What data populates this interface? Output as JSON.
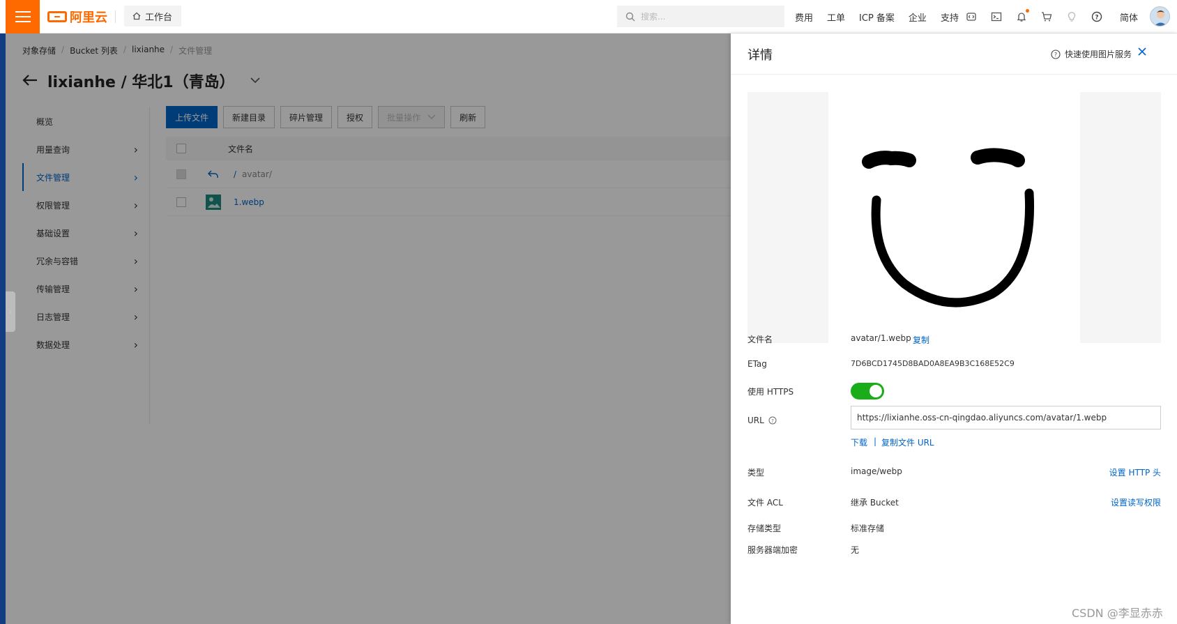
{
  "topbar": {
    "logo_text": "阿里云",
    "workbench": "工作台",
    "search_placeholder": "搜索...",
    "nav": [
      "费用",
      "工单",
      "ICP 备案",
      "企业",
      "支持"
    ],
    "lang": "简体"
  },
  "breadcrumb": [
    "对象存储",
    "Bucket 列表",
    "lixianhe",
    "文件管理"
  ],
  "page_title": "lixianhe / 华北1（青岛）",
  "sidebar": [
    {
      "label": "概览"
    },
    {
      "label": "用量查询"
    },
    {
      "label": "文件管理"
    },
    {
      "label": "权限管理"
    },
    {
      "label": "基础设置"
    },
    {
      "label": "冗余与容错"
    },
    {
      "label": "传输管理"
    },
    {
      "label": "日志管理"
    },
    {
      "label": "数据处理"
    }
  ],
  "toolbar": {
    "upload": "上传文件",
    "new_dir": "新建目录",
    "fragments": "碎片管理",
    "authorize": "授权",
    "batch": "批量操作",
    "refresh": "刷新"
  },
  "file_table": {
    "header_name": "文件名",
    "parent_prefix": "/",
    "parent_dir": "avatar/",
    "file_name": "1.webp"
  },
  "panel": {
    "title": "详情",
    "quick_link": "快速使用图片服务",
    "labels": {
      "filename": "文件名",
      "etag": "ETag",
      "https": "使用 HTTPS",
      "url": "URL",
      "type": "类型",
      "acl": "文件 ACL",
      "storage": "存储类型",
      "encryption": "服务器端加密"
    },
    "values": {
      "filename": "avatar/1.webp",
      "copy": "复制",
      "etag": "7D6BCD1745D8BAD0A8EA9B3C168E52C9",
      "url": "https://lixianhe.oss-cn-qingdao.aliyuncs.com/avatar/1.webp",
      "download": "下载",
      "separator": "|",
      "copy_url": "复制文件 URL",
      "type": "image/webp",
      "set_http_header": "设置 HTTP 头",
      "acl": "继承 Bucket",
      "set_acl": "设置读写权限",
      "storage": "标准存储",
      "encryption": "无"
    },
    "https_enabled": true
  },
  "watermark": "CSDN @李显赤赤",
  "colors": {
    "brand": "#ff6a00",
    "accent": "#0064c8",
    "toggle_on": "#1aad19"
  }
}
